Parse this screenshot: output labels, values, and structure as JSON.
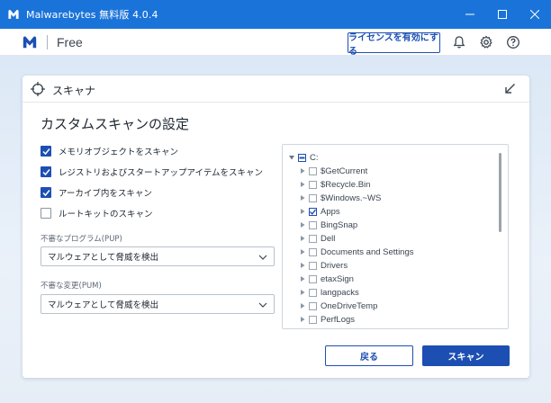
{
  "window": {
    "title": "Malwarebytes 無料版  4.0.4",
    "controls": [
      "minimize",
      "maximize",
      "close"
    ]
  },
  "header": {
    "brand": "Free",
    "license_button": "ライセンスを有効にする",
    "icons": [
      "bell-icon",
      "gear-icon",
      "help-icon"
    ]
  },
  "card": {
    "title": "スキャナ",
    "heading": "カスタムスキャンの設定",
    "options": [
      {
        "label": "メモリオブジェクトをスキャン",
        "checked": true
      },
      {
        "label": "レジストリおよびスタートアップアイテムをスキャン",
        "checked": true
      },
      {
        "label": "アーカイブ内をスキャン",
        "checked": true
      },
      {
        "label": "ルートキットのスキャン",
        "checked": false
      }
    ],
    "pup": {
      "label": "不審なプログラム(PUP)",
      "value": "マルウェアとして脅威を検出"
    },
    "pum": {
      "label": "不審な変更(PUM)",
      "value": "マルウェアとして脅威を検出"
    },
    "tree": {
      "root": {
        "label": "C:",
        "state": "partial",
        "expanded": true
      },
      "children": [
        {
          "label": "$GetCurrent",
          "checked": false
        },
        {
          "label": "$Recycle.Bin",
          "checked": false
        },
        {
          "label": "$Windows.~WS",
          "checked": false
        },
        {
          "label": "Apps",
          "checked": true
        },
        {
          "label": "BingSnap",
          "checked": false
        },
        {
          "label": "Dell",
          "checked": false
        },
        {
          "label": "Documents and Settings",
          "checked": false
        },
        {
          "label": "Drivers",
          "checked": false
        },
        {
          "label": "etaxSign",
          "checked": false
        },
        {
          "label": "langpacks",
          "checked": false
        },
        {
          "label": "OneDriveTemp",
          "checked": false
        },
        {
          "label": "PerfLogs",
          "checked": false
        }
      ]
    },
    "back_button": "戻る",
    "scan_button": "スキャン"
  },
  "colors": {
    "titlebar": "#1a73d9",
    "accent": "#1d4fb3"
  }
}
